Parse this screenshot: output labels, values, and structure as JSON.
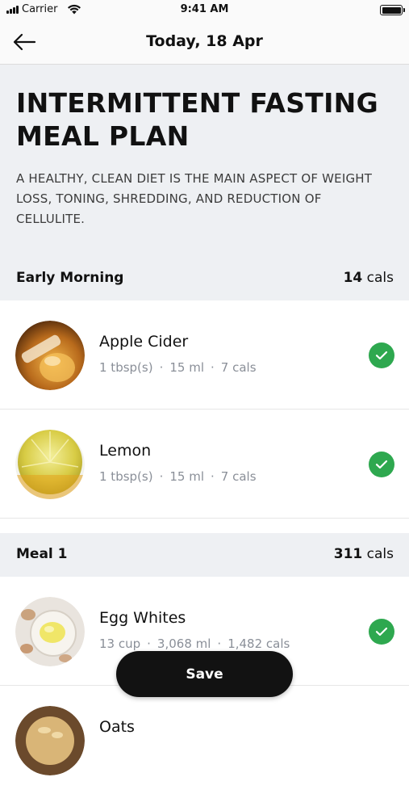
{
  "status_bar": {
    "carrier": "Carrier",
    "time": "9:41 AM"
  },
  "nav": {
    "title": "Today, 18 Apr"
  },
  "hero": {
    "title": "INTERMITTENT FASTING MEAL PLAN",
    "subtitle": "A HEALTHY, CLEAN DIET IS THE MAIN ASPECT OF WEIGHT LOSS, TONING, SHREDDING, AND REDUCTION OF CELLULITE."
  },
  "sections": [
    {
      "name": "Early Morning",
      "cals_value": "14",
      "cals_unit": "cals",
      "items": [
        {
          "name": "Apple Cider",
          "serving": "1 tbsp(s)",
          "volume": "15 ml",
          "cals": "7 cals",
          "checked": true
        },
        {
          "name": "Lemon",
          "serving": "1 tbsp(s)",
          "volume": "15 ml",
          "cals": "7 cals",
          "checked": true
        }
      ]
    },
    {
      "name": "Meal 1",
      "cals_value": "311",
      "cals_unit": "cals",
      "items": [
        {
          "name": "Egg Whites",
          "serving": "13 cup",
          "volume": "3,068 ml",
          "cals": "1,482 cals",
          "checked": true
        },
        {
          "name": "Oats"
        }
      ]
    }
  ],
  "meta_separator": "·",
  "save_label": "Save",
  "colors": {
    "check_green": "#2ea84f",
    "section_bg": "#eef0f3",
    "button_bg": "#121212"
  }
}
